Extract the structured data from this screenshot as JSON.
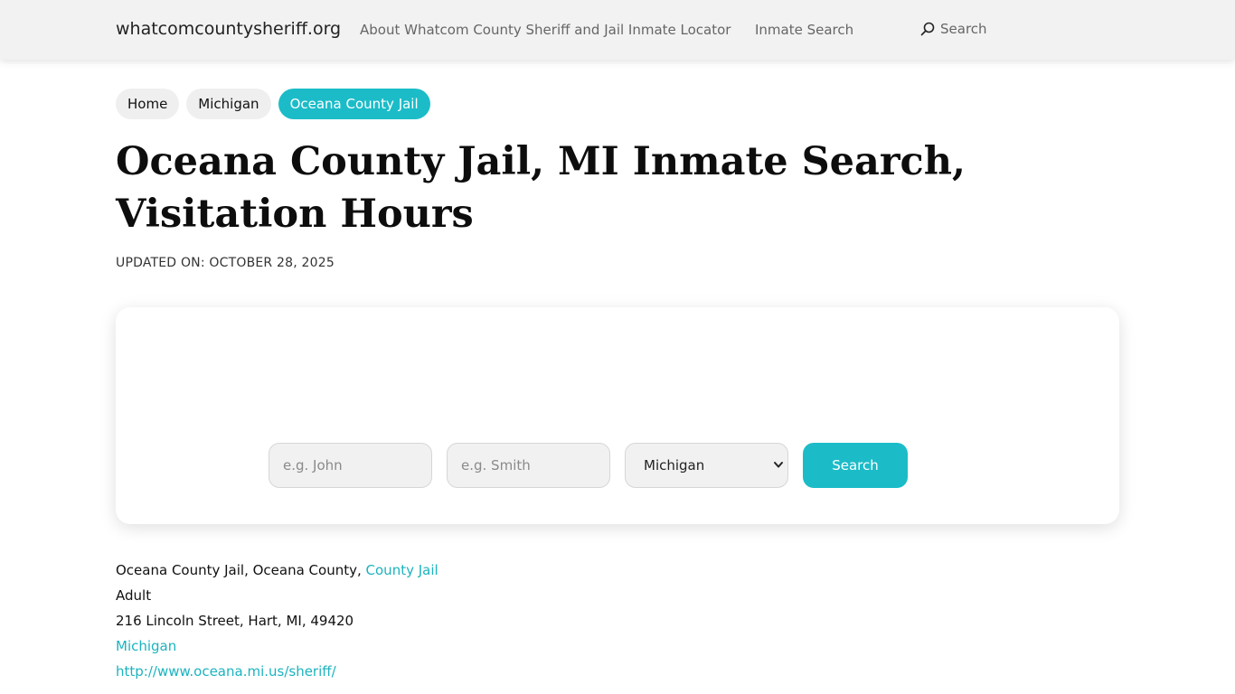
{
  "header": {
    "brand": "whatcomcountysheriff.org",
    "nav": {
      "about": "About Whatcom County Sheriff and Jail Inmate Locator",
      "inmate_search": "Inmate Search",
      "search": "Search"
    }
  },
  "breadcrumb": {
    "items": [
      "Home",
      "Michigan",
      "Oceana County Jail"
    ]
  },
  "page": {
    "title": "Oceana County Jail, MI Inmate Search, Visitation Hours",
    "updated": "UPDATED ON: OCTOBER 28, 2025"
  },
  "search_form": {
    "first_name_placeholder": "e.g. John",
    "last_name_placeholder": "e.g. Smith",
    "state_selected": "Michigan",
    "button_label": "Search"
  },
  "facility": {
    "name_prefix": "Oceana County Jail, Oceana County, ",
    "type_link": "County Jail",
    "category": "Adult",
    "address": "216 Lincoln Street, Hart, MI, 49420",
    "state_link": "Michigan",
    "website": "http://www.oceana.mi.us/sheriff/"
  },
  "colors": {
    "accent": "#1bbcc8",
    "header_bg": "#f2f2f2",
    "link": "#1bb3bf"
  },
  "icons": {
    "search": "search-icon",
    "select": "chevron-down-icon"
  }
}
